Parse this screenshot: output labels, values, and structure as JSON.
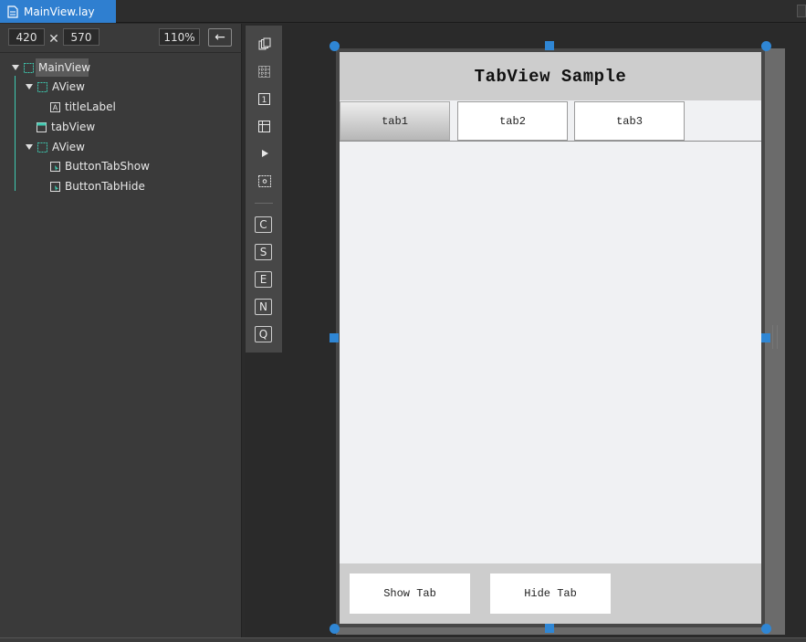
{
  "window": {
    "file_tab": "MainView.lay"
  },
  "size_bar": {
    "width": "420",
    "times": "✕",
    "height": "570",
    "zoom": "110%",
    "back": "←"
  },
  "tree": {
    "items": [
      {
        "label": "MainView",
        "icon": "view-outline-icon",
        "selected": true
      },
      {
        "label": "AView",
        "icon": "view-outline-icon"
      },
      {
        "label": "titleLabel",
        "icon": "label-a-icon"
      },
      {
        "label": "tabView",
        "icon": "tabview-icon"
      },
      {
        "label": "AView",
        "icon": "view-outline-icon"
      },
      {
        "label": "ButtonTabShow",
        "icon": "button-cursor-icon"
      },
      {
        "label": "ButtonTabHide",
        "icon": "button-cursor-icon"
      }
    ]
  },
  "toolbar": {
    "letter_buttons": [
      "C",
      "S",
      "E",
      "N",
      "Q"
    ],
    "icons": [
      "layers-icon",
      "grid-icon",
      "number-one-icon",
      "layout-icon",
      "play-icon",
      "select-frame-icon"
    ]
  },
  "preview": {
    "title": "TabView Sample",
    "tabs": [
      "tab1",
      "tab2",
      "tab3"
    ],
    "active_tab": "tab1",
    "buttons": [
      "Show Tab",
      "Hide Tab"
    ]
  },
  "colors": {
    "accent": "#2f86d4",
    "tree_line": "#3ec9b0",
    "file_tab": "#2f7fd0"
  }
}
